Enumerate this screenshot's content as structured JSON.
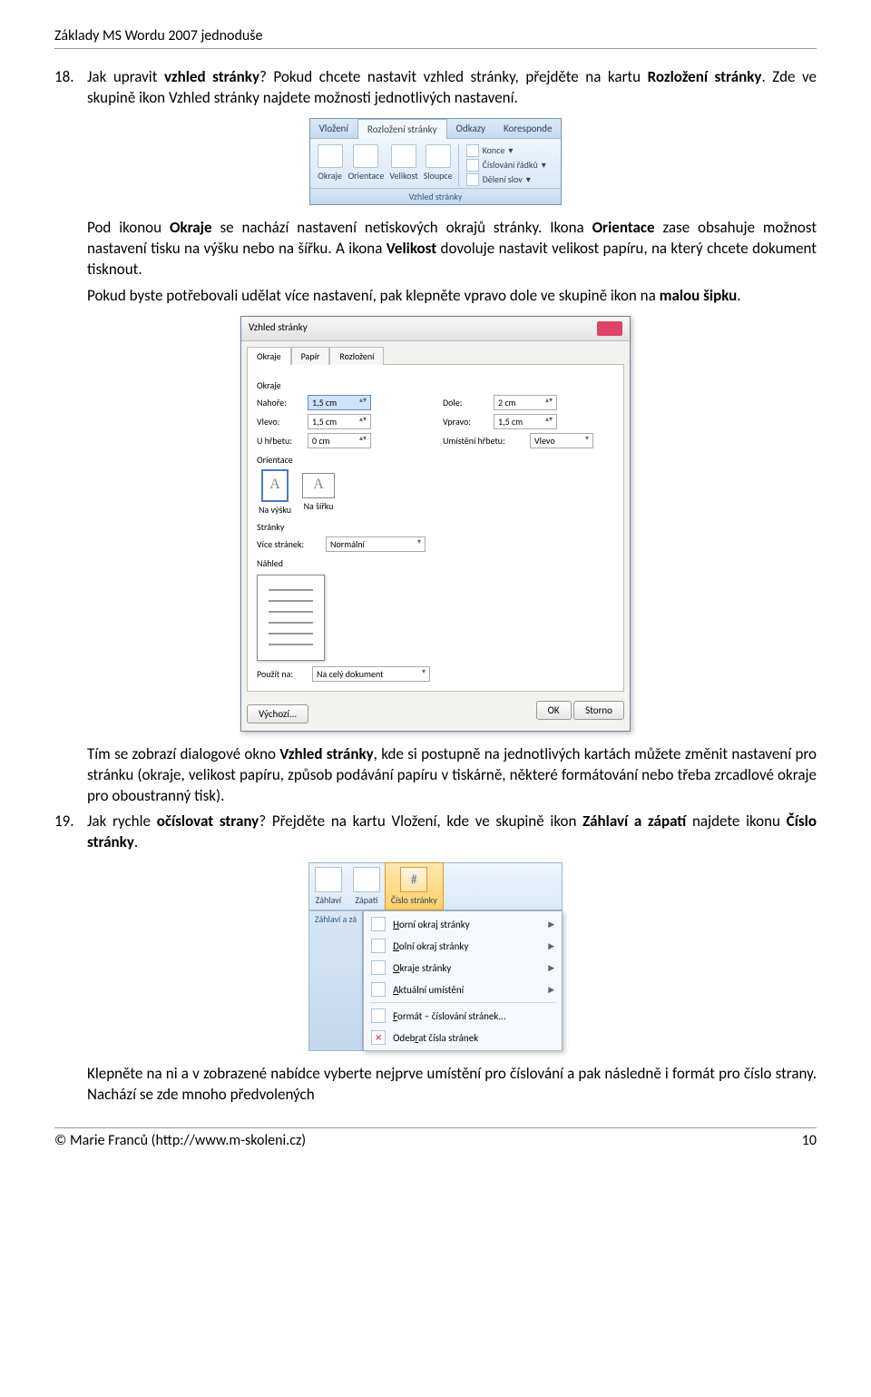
{
  "header": {
    "title": "Základy MS Wordu 2007 jednoduše"
  },
  "item18": {
    "num": "18.",
    "q_prefix": "Jak upravit ",
    "q_bold": "vzhled stránky",
    "q_suffix": "? Pokud chcete nastavit vzhled stránky, přejděte na kartu ",
    "q_bold2": "Rozložení stránky",
    "q_suffix2": ". Zde ve skupině ikon Vzhled stránky najdete možnosti jednotlivých nastavení."
  },
  "ribbon1": {
    "tabs": [
      "Vložení",
      "Rozložení stránky",
      "Odkazy",
      "Koresponde"
    ],
    "active_index": 1,
    "cols": [
      "Okraje",
      "Orientace",
      "Velikost",
      "Sloupce"
    ],
    "side": [
      "Konce",
      "Číslování řádků",
      "Dělení slov"
    ],
    "group": "Vzhled stránky"
  },
  "para2": {
    "t1": "Pod ikonou ",
    "b1": "Okraje",
    "t2": " se nachází nastavení netiskových okrajů stránky. Ikona ",
    "b2": "Orientace",
    "t3": " zase obsahuje možnost nastavení tisku na výšku nebo na šířku. A ikona ",
    "b3": "Velikost",
    "t4": " dovoluje nastavit velikost papíru, na který chcete dokument tisknout."
  },
  "para3": {
    "t1": "Pokud byste potřebovali udělat více nastavení, pak klepněte vpravo dole ve skupině ikon na ",
    "b1": "malou šipku",
    "t2": "."
  },
  "dialog": {
    "title": "Vzhled stránky",
    "tabs": [
      "Okraje",
      "Papír",
      "Rozložení"
    ],
    "group_margins": "Okraje",
    "fields": {
      "top_label": "Nahoře:",
      "top_val": "1,5 cm",
      "bottom_label": "Dole:",
      "bottom_val": "2 cm",
      "left_label": "Vlevo:",
      "left_val": "1,5 cm",
      "right_label": "Vpravo:",
      "right_val": "1,5 cm",
      "gutter_label": "U hřbetu:",
      "gutter_val": "0 cm",
      "gutterpos_label": "Umístění hřbetu:",
      "gutterpos_val": "Vlevo"
    },
    "group_orient": "Orientace",
    "orient_portrait": "Na výšku",
    "orient_landscape": "Na šířku",
    "group_pages": "Stránky",
    "pages_label": "Více stránek:",
    "pages_val": "Normální",
    "group_preview": "Náhled",
    "apply_label": "Použít na:",
    "apply_val": "Na celý dokument",
    "btn_default": "Výchozí...",
    "btn_ok": "OK",
    "btn_cancel": "Storno"
  },
  "para4": {
    "t1": "Tím se zobrazí dialogové okno ",
    "b1": "Vzhled stránky",
    "t2": ", kde si postupně na jednotlivých kartách můžete změnit nastavení pro stránku (okraje, velikost papíru, způsob podávání papíru v tiskárně, některé formátování nebo třeba zrcadlové okraje pro oboustranný tisk)."
  },
  "item19": {
    "num": "19.",
    "t1": "Jak rychle ",
    "b1": "očíslovat strany",
    "t2": "? Přejděte na kartu Vložení, kde ve skupině ikon ",
    "b2": "Záhlaví a zápatí",
    "t3": " najdete ikonu ",
    "b3": "Číslo stránky",
    "t4": "."
  },
  "hf": {
    "cols": [
      "Záhlaví",
      "Zápatí",
      "Číslo stránky"
    ],
    "group": "Záhlaví a zá",
    "menu": [
      {
        "label": "Horní okraj stránky",
        "sub": true,
        "u": 0
      },
      {
        "label": "Dolní okraj stránky",
        "sub": true,
        "u": 0
      },
      {
        "label": "Okraje stránky",
        "sub": true,
        "u": 0
      },
      {
        "label": "Aktuální umístění",
        "sub": true,
        "u": 0
      },
      {
        "sep": true
      },
      {
        "label": "Formát – číslování stránek...",
        "sub": false,
        "u": 0
      },
      {
        "label": "Odebrat čísla stránek",
        "sub": false,
        "u": 4,
        "del": true
      }
    ]
  },
  "para5": "Klepněte na ni a v zobrazené nabídce vyberte nejprve umístění pro číslování a pak následně i formát pro číslo strany. Nachází se zde mnoho předvolených",
  "footer": {
    "left": "© Marie Franců (http://www.m-skoleni.cz)",
    "right": "10"
  }
}
